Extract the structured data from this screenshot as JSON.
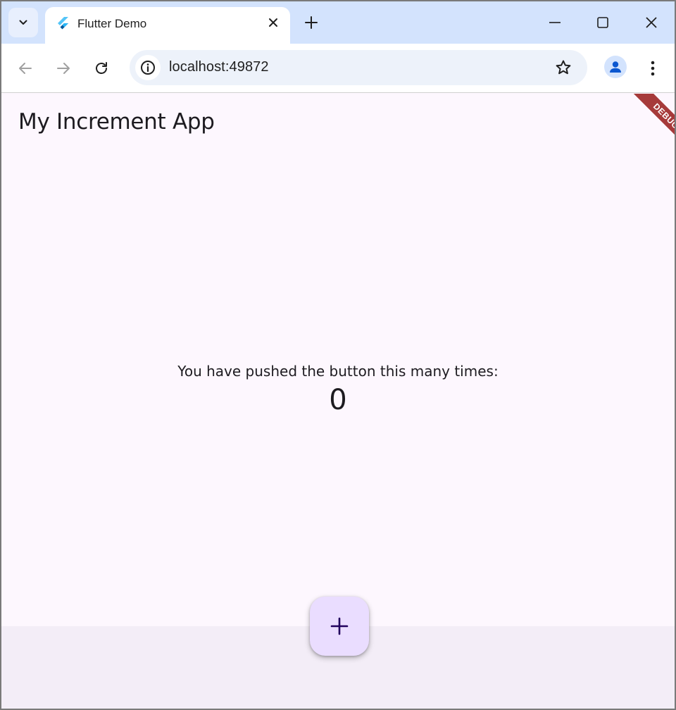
{
  "browser": {
    "tab": {
      "title": "Flutter Demo",
      "favicon": "flutter-icon"
    },
    "address_bar": {
      "url": "localhost:49872"
    },
    "icons": {
      "tab_search": "chevron-down-icon",
      "close_tab": "close-icon",
      "new_tab": "plus-icon",
      "minimize": "minimize-icon",
      "maximize": "maximize-icon",
      "close_window": "close-icon",
      "back": "arrow-left-icon",
      "forward": "arrow-right-icon",
      "reload": "reload-icon",
      "site_info": "info-icon",
      "bookmark": "star-icon",
      "profile": "person-icon",
      "menu": "kebab-menu-icon"
    }
  },
  "app": {
    "title": "My Increment App",
    "debug_banner": "DEBUG",
    "counter": {
      "label": "You have pushed the button this many times:",
      "value": "0"
    },
    "fab_icon": "plus-icon"
  },
  "colors": {
    "tab_strip": "#d3e3fd",
    "app_background": "#fdf7fe",
    "bottom_bar": "#f3edf7",
    "fab": "#eaddff",
    "debug_banner": "#a63a3a",
    "text": "#1d1b20"
  }
}
